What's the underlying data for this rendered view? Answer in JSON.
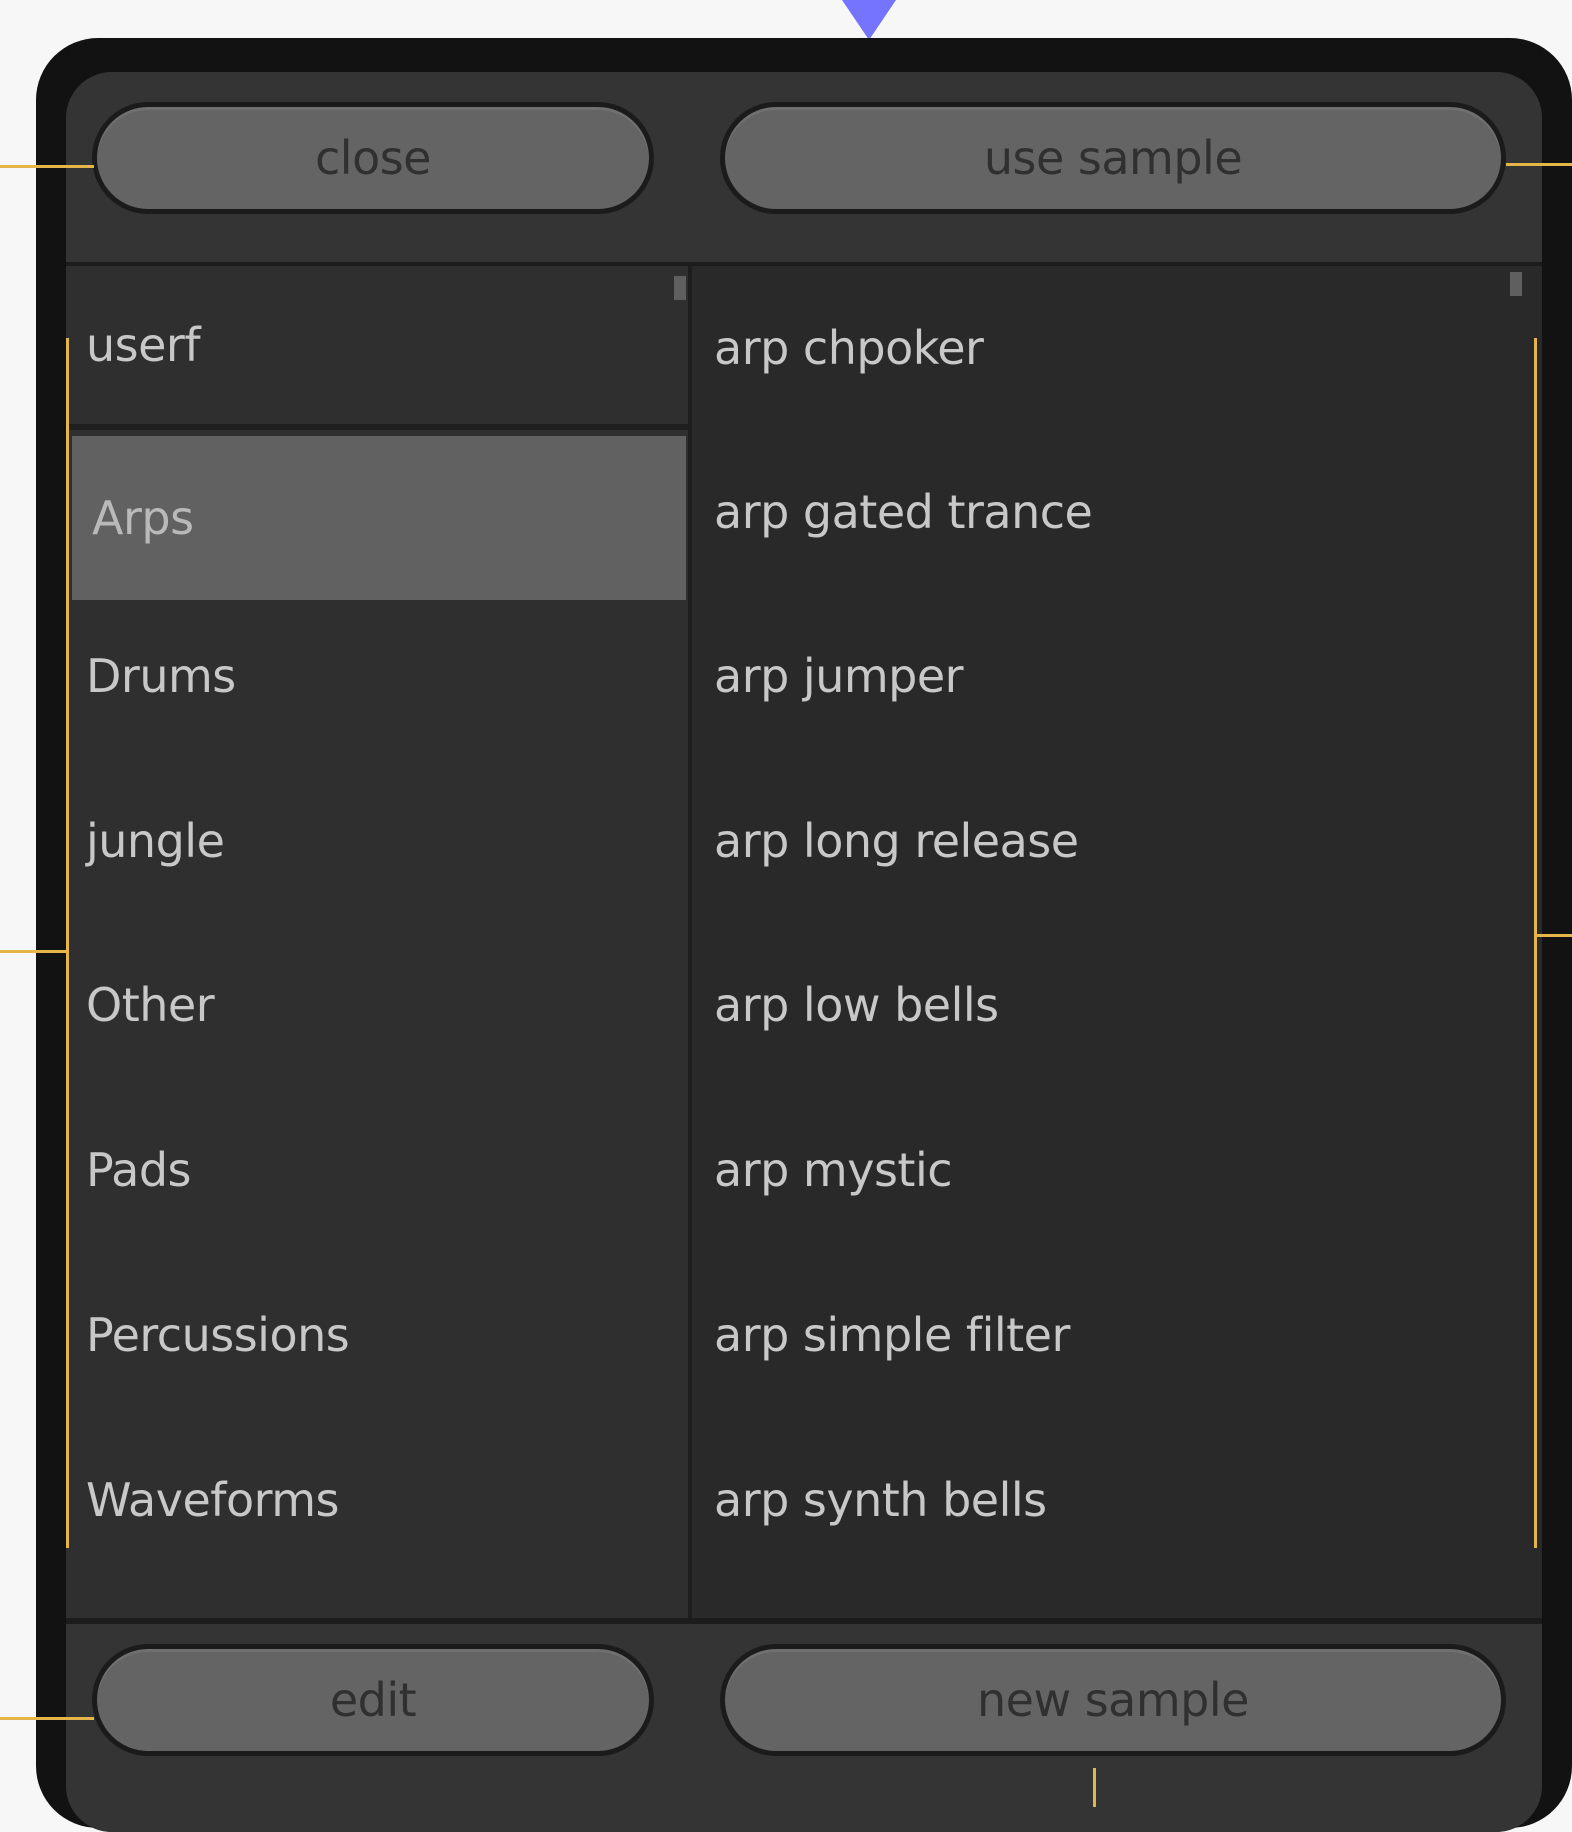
{
  "header": {
    "close_label": "close",
    "use_sample_label": "use sample"
  },
  "categories": {
    "items": [
      {
        "label": "userf"
      },
      {
        "label": "Arps"
      },
      {
        "label": "Drums"
      },
      {
        "label": "jungle"
      },
      {
        "label": "Other"
      },
      {
        "label": "Pads"
      },
      {
        "label": "Percussions"
      },
      {
        "label": "Waveforms"
      }
    ],
    "selected": "Arps"
  },
  "samples": {
    "items": [
      {
        "label": "arp chpoker"
      },
      {
        "label": "arp gated trance"
      },
      {
        "label": "arp jumper"
      },
      {
        "label": "arp long release"
      },
      {
        "label": "arp low bells"
      },
      {
        "label": "arp mystic"
      },
      {
        "label": "arp simple filter"
      },
      {
        "label": "arp synth bells"
      }
    ]
  },
  "footer": {
    "edit_label": "edit",
    "new_sample_label": "new sample"
  },
  "colors": {
    "pointer": "#7474ff",
    "callout": "#e5b54a",
    "panel": "#2b2b2b",
    "button": "#646464",
    "selected_row": "#616161"
  }
}
